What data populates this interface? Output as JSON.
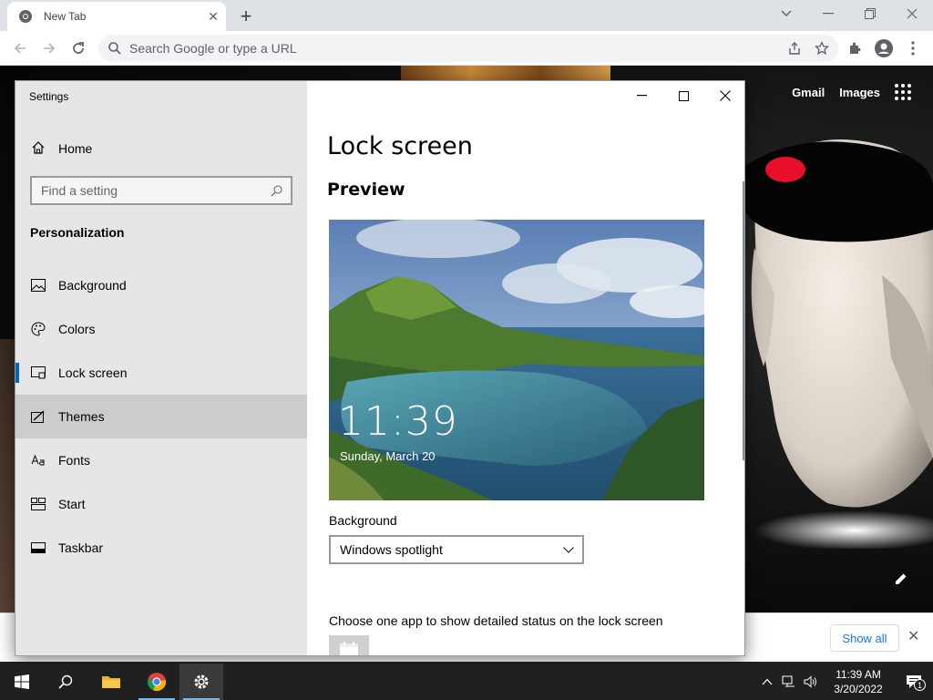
{
  "browser": {
    "tab_title": "New Tab",
    "omnibox_placeholder": "Search Google or type a URL",
    "icons": [
      "chrome-icon",
      "tab-close-icon",
      "new-tab-icon",
      "back-icon",
      "forward-icon",
      "reload-icon",
      "search-icon",
      "share-icon",
      "star-icon",
      "extensions-icon",
      "profile-icon",
      "menu-icon"
    ]
  },
  "newtab": {
    "gmail": "Gmail",
    "images": "Images",
    "show_all": "Show all"
  },
  "settings": {
    "window_title": "Settings",
    "home": "Home",
    "search_placeholder": "Find a setting",
    "section": "Personalization",
    "nav": [
      {
        "label": "Background",
        "icon": "picture-icon"
      },
      {
        "label": "Colors",
        "icon": "palette-icon"
      },
      {
        "label": "Lock screen",
        "icon": "lock-screen-icon",
        "active": true
      },
      {
        "label": "Themes",
        "icon": "themes-icon",
        "hover": true
      },
      {
        "label": "Fonts",
        "icon": "fonts-icon"
      },
      {
        "label": "Start",
        "icon": "start-icon"
      },
      {
        "label": "Taskbar",
        "icon": "taskbar-icon"
      }
    ],
    "page_title": "Lock screen",
    "preview_heading": "Preview",
    "preview_time": "11:39",
    "preview_date": "Sunday, March 20",
    "background_label": "Background",
    "background_value": "Windows spotlight",
    "app_status_label": "Choose one app to show detailed status on the lock screen",
    "accent_color": "#0067c0"
  },
  "taskbar": {
    "time": "11:39 AM",
    "date": "3/20/2022",
    "notification_count": "1"
  }
}
